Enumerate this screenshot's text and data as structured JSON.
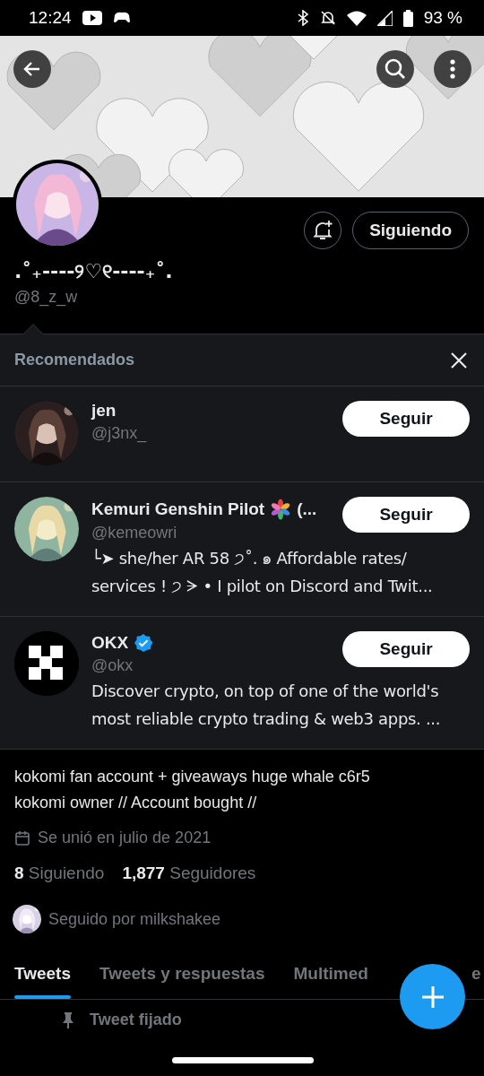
{
  "status_bar": {
    "time": "12:24",
    "battery": "93 %"
  },
  "profile": {
    "name": ".˚₊----୨♡୧----₊˚.",
    "handle": "@8_z_w",
    "follow_button": "Siguiendo",
    "notifications_on": false
  },
  "recommendations": {
    "title": "Recomendados",
    "accounts": [
      {
        "name": "jen",
        "handle": "@j3nx_",
        "verified": false,
        "emoji": false,
        "button": "Seguir"
      },
      {
        "name": "Kemuri Genshin Pilot",
        "name_suffix": "(...",
        "handle": "@kemeowri",
        "bio_lines": [
          "└➤ she/her AR 58 ੭˚. ๑  Affordable rates/",
          "services ! ੭  ᗒ • I pilot on Discord and Twit..."
        ],
        "verified": false,
        "emoji": true,
        "button": "Seguir"
      },
      {
        "kind": "logo",
        "name": "OKX",
        "handle": "@okx",
        "bio_lines": [
          "Discover crypto, on top of one of the world's",
          "most reliable crypto trading & web3 apps. ..."
        ],
        "verified": true,
        "emoji": false,
        "button": "Seguir"
      }
    ]
  },
  "bio_lines": [
    "kokomi fan account + giveaways huge whale c6r5",
    "kokomi owner // Account bought //"
  ],
  "joined": "Se unió en julio de 2021",
  "stats": [
    {
      "count": "8",
      "label": "Siguiendo"
    },
    {
      "count": "1,877",
      "label": "Seguidores"
    }
  ],
  "followed_by": "Seguido por milkshakee",
  "tabs": [
    {
      "label": "Tweets",
      "selected": true
    },
    {
      "label": "Tweets y respuestas",
      "selected": false
    },
    {
      "label": "Multimed",
      "selected": false
    },
    {
      "label": "e",
      "selected": false
    }
  ],
  "pinned": "Tweet fijado"
}
